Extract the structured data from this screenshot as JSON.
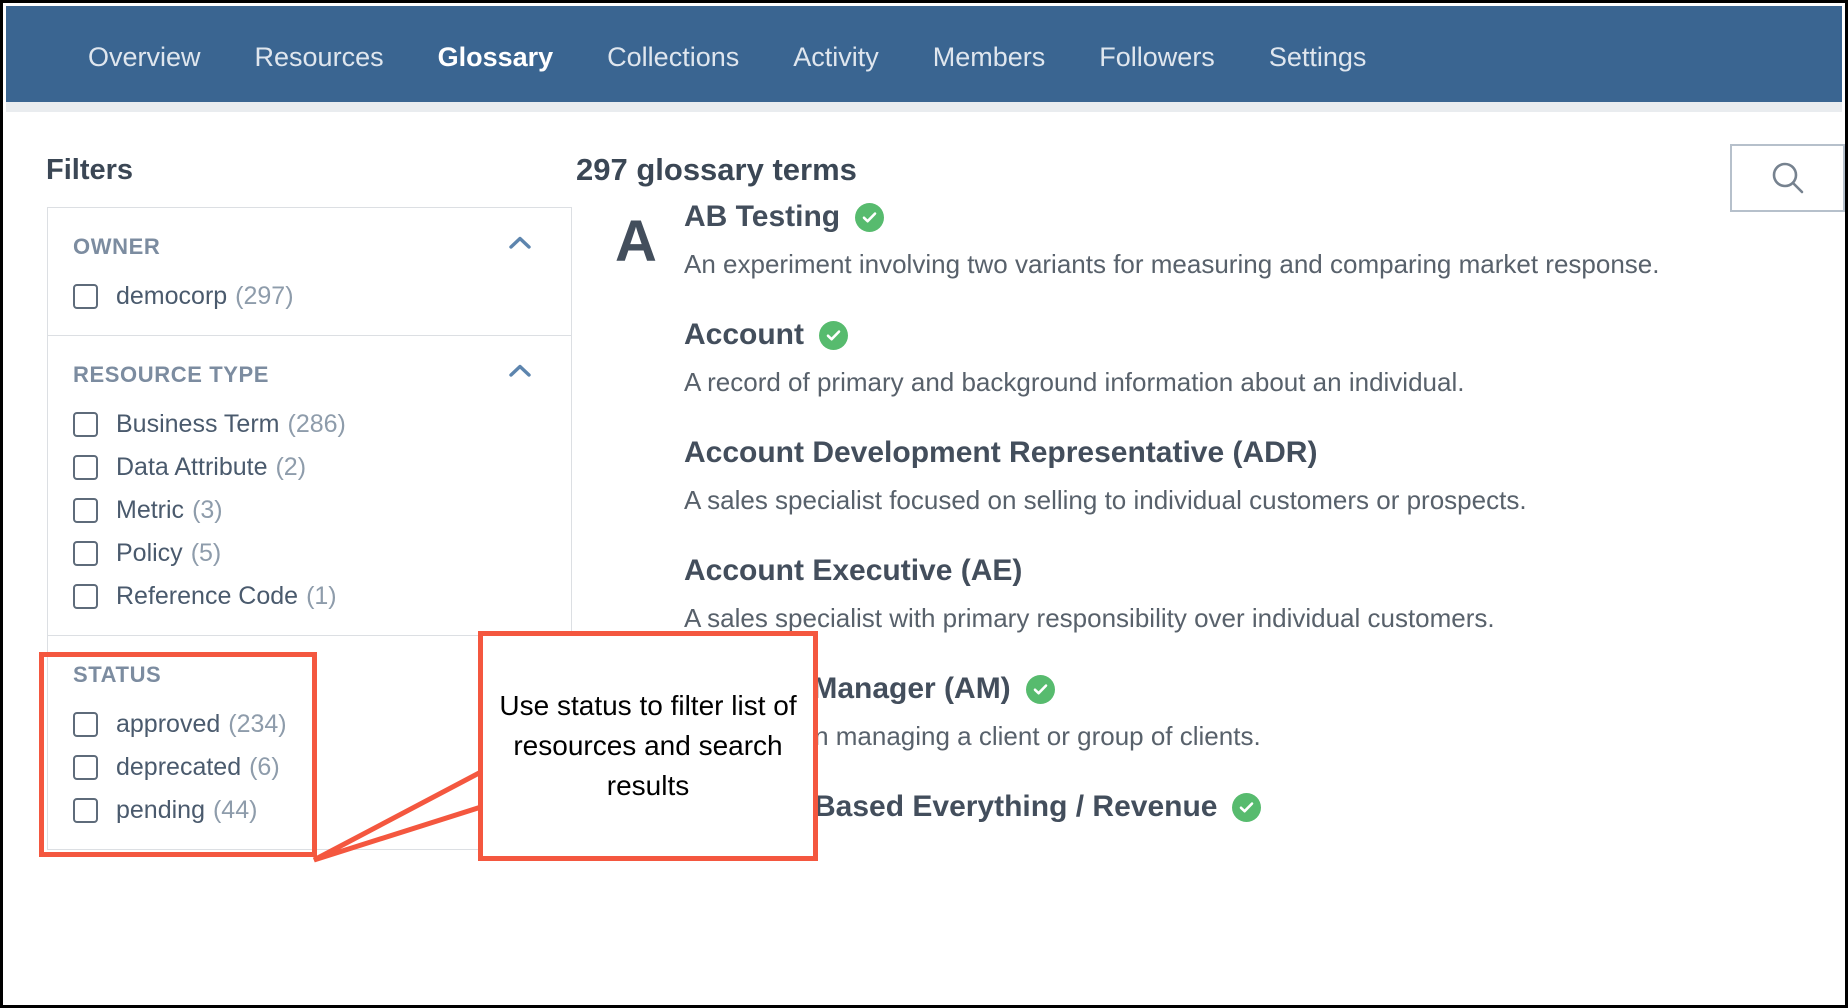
{
  "nav": {
    "items": [
      {
        "label": "Overview",
        "active": false
      },
      {
        "label": "Resources",
        "active": false
      },
      {
        "label": "Glossary",
        "active": true
      },
      {
        "label": "Collections",
        "active": false
      },
      {
        "label": "Activity",
        "active": false
      },
      {
        "label": "Members",
        "active": false
      },
      {
        "label": "Followers",
        "active": false
      },
      {
        "label": "Settings",
        "active": false
      }
    ],
    "accent_color": "#4dc3e0",
    "bar_color": "#3a6591"
  },
  "sidebar": {
    "title": "Filters",
    "groups": [
      {
        "name": "OWNER",
        "collapse_icon": "chevron-up-icon",
        "items": [
          {
            "label": "democorp",
            "count": "(297)",
            "checked": false
          }
        ]
      },
      {
        "name": "RESOURCE TYPE",
        "collapse_icon": "chevron-up-icon",
        "items": [
          {
            "label": "Business Term",
            "count": "(286)",
            "checked": false
          },
          {
            "label": "Data Attribute",
            "count": "(2)",
            "checked": false
          },
          {
            "label": "Metric",
            "count": "(3)",
            "checked": false
          },
          {
            "label": "Policy",
            "count": "(5)",
            "checked": false
          },
          {
            "label": "Reference Code",
            "count": "(1)",
            "checked": false
          }
        ]
      },
      {
        "name": "STATUS",
        "collapse_icon": "chevron-up-icon",
        "items": [
          {
            "label": "approved",
            "count": "(234)",
            "checked": false
          },
          {
            "label": "deprecated",
            "count": "(6)",
            "checked": false
          },
          {
            "label": "pending",
            "count": "(44)",
            "checked": false
          }
        ]
      }
    ]
  },
  "main": {
    "title": "297 glossary terms",
    "search": {
      "icon": "search-icon",
      "placeholder": ""
    },
    "letter_group": "A",
    "terms": [
      {
        "name": "AB Testing",
        "approved": true,
        "description": "An experiment involving two variants for measuring and comparing market response."
      },
      {
        "name": "Account",
        "approved": true,
        "description": "A record of primary and background information about an individual."
      },
      {
        "name": "Account Development Representative (ADR)",
        "approved": false,
        "description": "A sales specialist focused on selling to individual customers or prospects."
      },
      {
        "name": "Account Executive (AE)",
        "approved": false,
        "description": "A sales specialist with primary responsibility over individual customers."
      },
      {
        "name": "Account Manager (AM)",
        "approved": true,
        "description": "Salesperson managing a client or group of clients."
      },
      {
        "name": "Account-Based Everything / Revenue",
        "approved": true,
        "description": ""
      }
    ]
  },
  "annotation": {
    "text": "Use status to filter list of resources and search results",
    "color": "#f4573f",
    "highlight_target": "STATUS"
  }
}
